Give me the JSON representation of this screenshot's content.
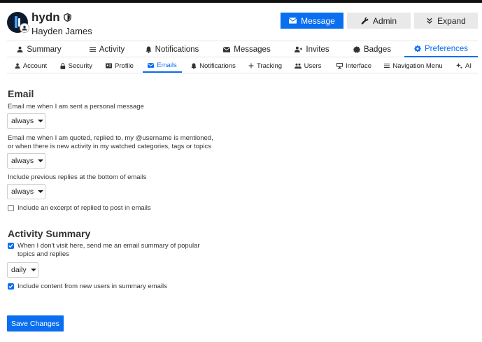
{
  "user": {
    "username": "hydn",
    "full_name": "Hayden James",
    "icons": {
      "avatar_badge": "user-icon",
      "moderator": "shield-icon"
    }
  },
  "header_buttons": [
    {
      "label": "Message",
      "icon": "envelope-icon"
    },
    {
      "label": "Admin",
      "icon": "wrench-icon"
    },
    {
      "label": "Expand",
      "icon": "chevrons-down-icon"
    }
  ],
  "tabs": [
    {
      "label": "Summary",
      "icon": "user-icon"
    },
    {
      "label": "Activity",
      "icon": "list-icon"
    },
    {
      "label": "Notifications",
      "icon": "bell-icon"
    },
    {
      "label": "Messages",
      "icon": "envelope-icon"
    },
    {
      "label": "Invites",
      "icon": "user-plus-icon"
    },
    {
      "label": "Badges",
      "icon": "badge-icon"
    },
    {
      "label": "Preferences",
      "icon": "gear-icon",
      "active": true
    }
  ],
  "subtabs": [
    {
      "label": "Account",
      "icon": "user-icon"
    },
    {
      "label": "Security",
      "icon": "lock-icon"
    },
    {
      "label": "Profile",
      "icon": "id-card-icon"
    },
    {
      "label": "Emails",
      "icon": "envelope-icon",
      "active": true
    },
    {
      "label": "Notifications",
      "icon": "bell-icon"
    },
    {
      "label": "Tracking",
      "icon": "plus-icon"
    },
    {
      "label": "Users",
      "icon": "users-icon"
    },
    {
      "label": "Interface",
      "icon": "desktop-icon"
    },
    {
      "label": "Navigation Menu",
      "icon": "bars-icon"
    },
    {
      "label": "AI",
      "icon": "sparkle-icon"
    }
  ],
  "email": {
    "title": "Email",
    "personal_message_label": "Email me when I am sent a personal message",
    "personal_message_value": "always",
    "quoted_label_line1": "Email me when I am quoted, replied to, my @username is mentioned,",
    "quoted_label_line2": "or when there is new activity in my watched categories, tags or topics",
    "quoted_value": "always",
    "previous_replies_label": "Include previous replies at the bottom of emails",
    "previous_replies_value": "always",
    "excerpt_label": "Include an excerpt of replied to post in emails",
    "excerpt_checked": false
  },
  "activity_summary": {
    "title": "Activity Summary",
    "digest_label_line1": "When I don't visit here, send me an email summary of popular",
    "digest_label_line2": "topics and replies",
    "digest_checked": true,
    "digest_frequency": "daily",
    "new_users_label": "Include content from new users in summary emails",
    "new_users_checked": true
  },
  "save_label": "Save Changes",
  "colors": {
    "accent": "#0a6ef0",
    "neutral_button": "#e9e9e9",
    "top_bar": "#111111"
  }
}
